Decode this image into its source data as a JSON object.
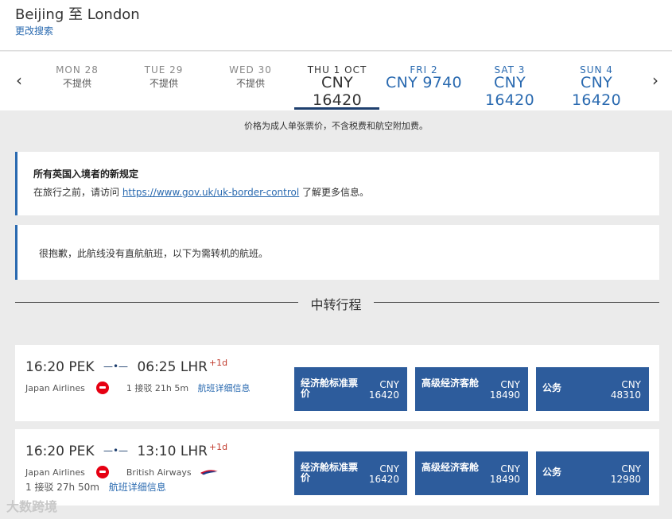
{
  "header": {
    "route_title": "Beijing 至 London",
    "modify_link": "更改搜索"
  },
  "date_nav": {
    "prev_icon": "chevron-left-icon",
    "next_icon": "chevron-right-icon",
    "dates": [
      {
        "day": "MON 28",
        "value": "不提供",
        "state": "unavailable"
      },
      {
        "day": "TUE 29",
        "value": "不提供",
        "state": "unavailable"
      },
      {
        "day": "WED 30",
        "value": "不提供",
        "state": "unavailable"
      },
      {
        "day": "THU 1 OCT",
        "value": "CNY 16420",
        "state": "selected"
      },
      {
        "day": "FRI 2",
        "value": "CNY 9740",
        "state": "available"
      },
      {
        "day": "SAT 3",
        "value": "CNY 16420",
        "state": "available"
      },
      {
        "day": "SUN 4",
        "value": "CNY 16420",
        "state": "available"
      }
    ]
  },
  "price_note": "价格为成人单张票价，不含税费和航空附加费。",
  "notice_uk": {
    "title": "所有英国入境者的新规定",
    "text_before": "在旅行之前，请访问 ",
    "link": "https://www.gov.uk/uk-border-control",
    "text_after": " 了解更多信息。"
  },
  "notice_direct": {
    "text": "很抱歉，此航线没有直航航班，以下为需转机的航班。"
  },
  "section_divider": "中转行程",
  "flights": [
    {
      "depart_time": "16:20",
      "depart_airport": "PEK",
      "arrive_time": "06:25",
      "arrive_airport": "LHR",
      "day_offset": "+1d",
      "airlines": [
        "Japan Airlines"
      ],
      "stops": "1 接驳",
      "duration": "21h 5m",
      "detail_link": "航班详细信息",
      "fares": [
        {
          "name": "经济舱标准票价",
          "currency": "CNY",
          "price": "16420"
        },
        {
          "name": "高级经济客舱",
          "currency": "CNY",
          "price": "18490"
        },
        {
          "name": "公务",
          "currency": "CNY",
          "price": "48310"
        }
      ]
    },
    {
      "depart_time": "16:20",
      "depart_airport": "PEK",
      "arrive_time": "13:10",
      "arrive_airport": "LHR",
      "day_offset": "+1d",
      "airlines": [
        "Japan Airlines",
        "British Airways"
      ],
      "stops": "1 接驳",
      "duration": "27h 50m",
      "detail_link": "航班详细信息",
      "fares": [
        {
          "name": "经济舱标准票价",
          "currency": "CNY",
          "price": "16420"
        },
        {
          "name": "高级经济客舱",
          "currency": "CNY",
          "price": "18490"
        },
        {
          "name": "公务",
          "currency": "CNY",
          "price": "12980"
        }
      ]
    }
  ],
  "watermark": "大数跨境",
  "colors": {
    "accent_blue": "#2a6ab0",
    "fare_button": "#2d5c9c",
    "selected_underline": "#1e3f6e",
    "day_offset": "#c0392b"
  }
}
